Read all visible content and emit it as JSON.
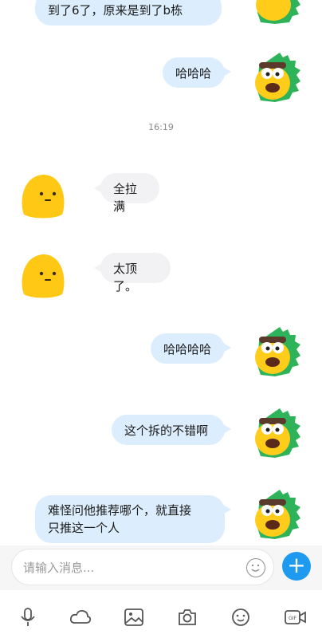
{
  "messages": [
    {
      "side": "right",
      "text": "到了6了，原来是到了b栋"
    },
    {
      "side": "right",
      "text": "哈哈哈"
    },
    {
      "time": "16:19"
    },
    {
      "side": "left",
      "text": "全拉满"
    },
    {
      "side": "left",
      "text": "太顶了。"
    },
    {
      "side": "right",
      "text": "哈哈哈哈"
    },
    {
      "side": "right",
      "text": "这个拆的不错啊"
    },
    {
      "side": "right",
      "text_line1": "难怪问他推荐哪个，就直接",
      "text_line2": "只推这一个人"
    }
  ],
  "input": {
    "placeholder": "请输入消息..."
  },
  "toolbar": {
    "plus_label": "+",
    "gif_label": "GIF"
  },
  "colors": {
    "out_bubble": "#dceefe",
    "in_bubble": "#f2f2f4",
    "accent": "#1e9bf0"
  },
  "icons": [
    "voice-icon",
    "cloud-icon",
    "image-icon",
    "camera-icon",
    "emoji-icon",
    "gif-icon"
  ]
}
